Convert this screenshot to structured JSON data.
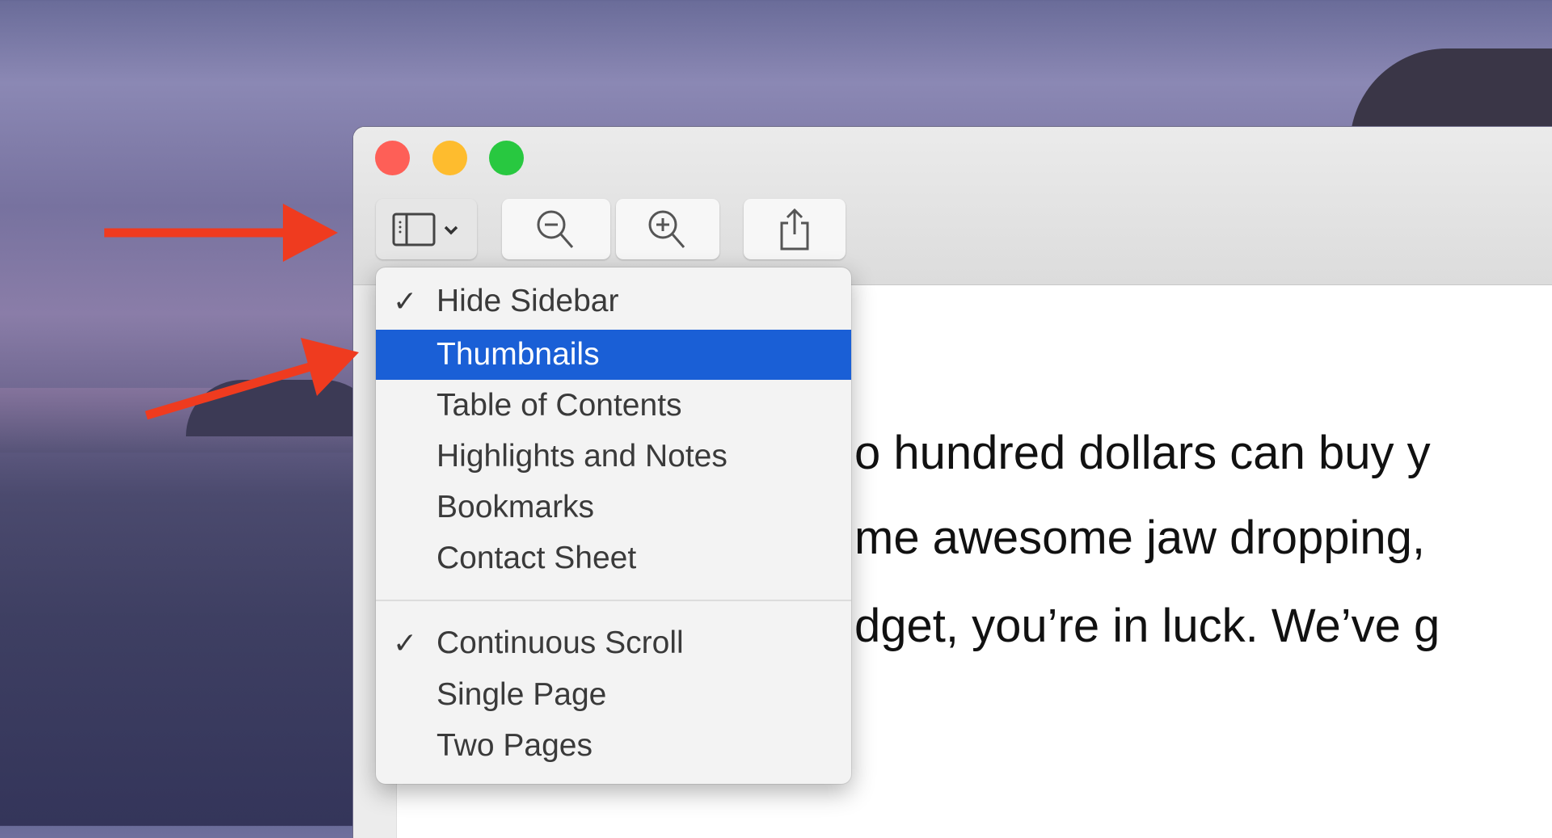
{
  "colors": {
    "highlight": "#1a5fd6",
    "arrow": "#ef3b1f",
    "close": "#fe5f57",
    "minimize": "#febc2e",
    "zoom": "#28c840"
  },
  "window_controls": [
    {
      "name": "close"
    },
    {
      "name": "minimize"
    },
    {
      "name": "zoom"
    }
  ],
  "toolbar": {
    "buttons": [
      {
        "icon": "sidebar-icon",
        "extra": "chevron-down-icon"
      },
      {
        "icon": "zoom-out-icon"
      },
      {
        "icon": "zoom-in-icon"
      },
      {
        "icon": "share-icon"
      }
    ]
  },
  "menu": {
    "items": [
      {
        "label": "Hide Sidebar",
        "checked": true,
        "check": "✓"
      },
      {
        "label": "Thumbnails",
        "selected": true
      },
      {
        "label": "Table of Contents"
      },
      {
        "label": "Highlights and Notes"
      },
      {
        "label": "Bookmarks"
      },
      {
        "label": "Contact Sheet"
      },
      {
        "label": "Continuous Scroll",
        "checked": true,
        "check": "✓"
      },
      {
        "label": "Single Page"
      },
      {
        "label": "Two Pages"
      }
    ]
  },
  "document": {
    "lines": [
      "o hundred dollars can buy y",
      "me awesome jaw dropping,",
      "dget, you’re in luck. We’ve g"
    ]
  }
}
